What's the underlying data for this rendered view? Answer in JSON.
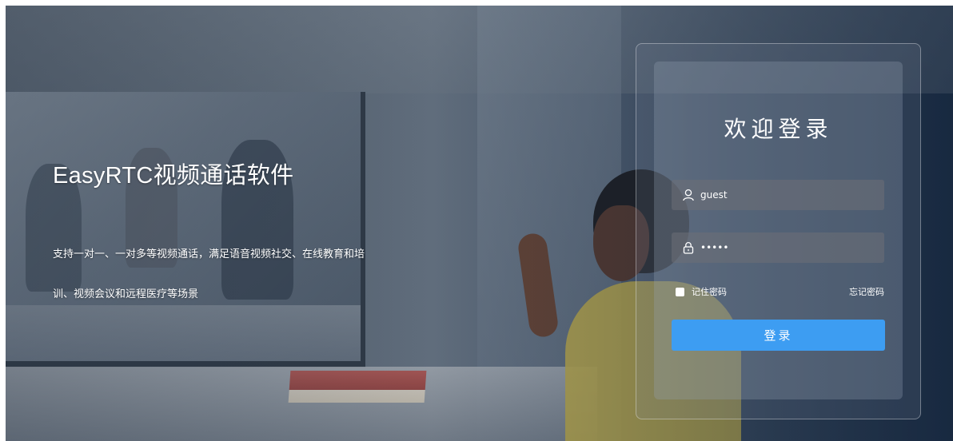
{
  "hero": {
    "title": "EasyRTC视频通话软件",
    "description": "支持一对一、一对多等视频通话，满足语音视频社交、在线教育和培训、视频会议和远程医疗等场景"
  },
  "login": {
    "title": "欢迎登录",
    "username": {
      "value": "guest",
      "icon": "user-icon"
    },
    "password": {
      "value": "•••••",
      "icon": "lock-icon"
    },
    "remember_label": "记住密码",
    "remember_checked": false,
    "forgot_label": "忘记密码",
    "submit_label": "登录"
  },
  "colors": {
    "primary_button": "#3d9df2",
    "text": "#ffffff"
  }
}
